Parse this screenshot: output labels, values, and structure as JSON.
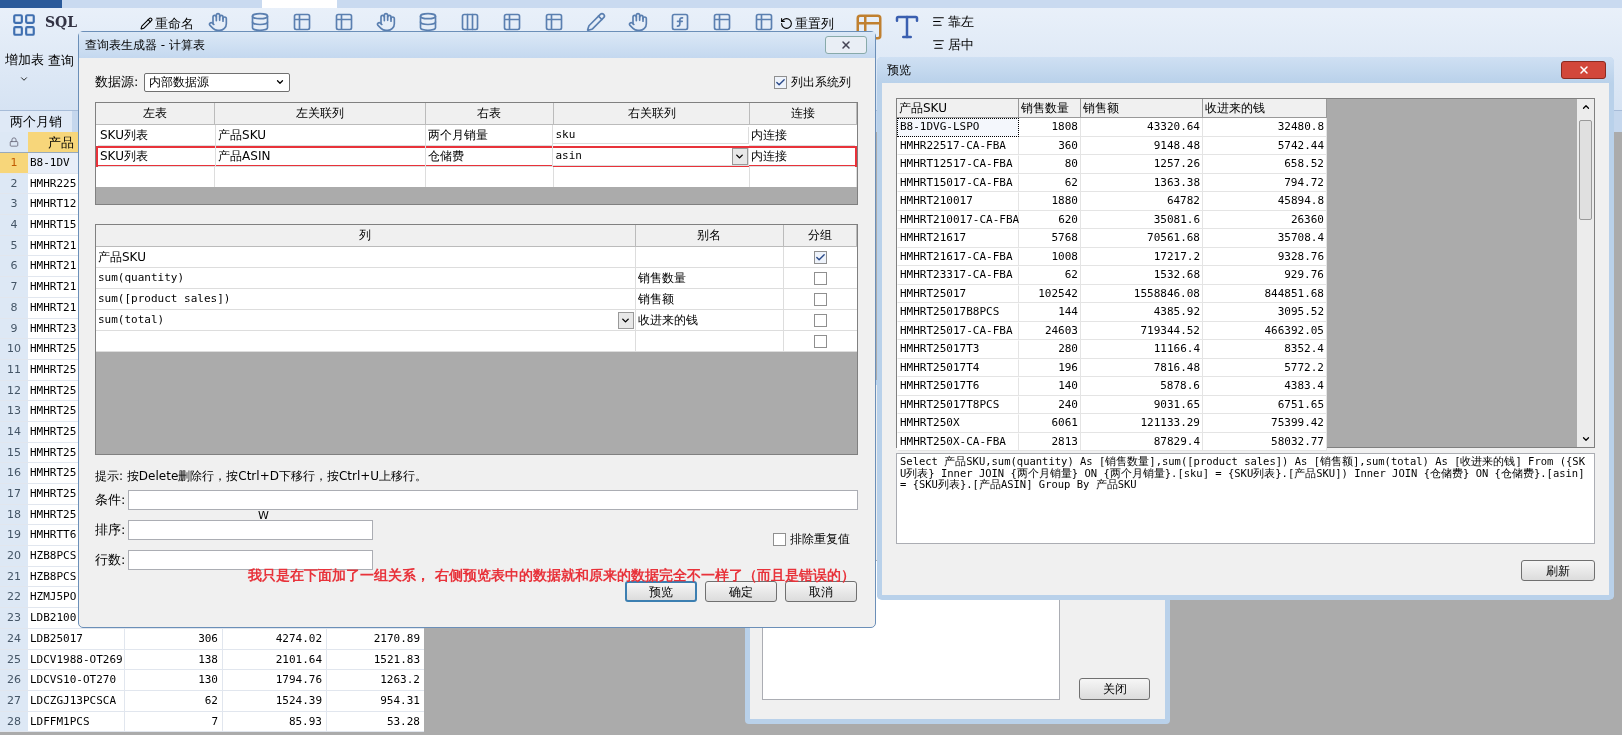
{
  "ribbon": {
    "big_buttons": [
      {
        "label": "增加表"
      },
      {
        "label": "查询"
      }
    ],
    "sql_label": "SQL",
    "small_buttons": [
      {
        "label": "重命名"
      },
      {
        "label": "重置列"
      }
    ],
    "align_buttons": [
      {
        "label": "靠左"
      },
      {
        "label": "居中"
      }
    ]
  },
  "sheet_tab": {
    "label": "两个月销"
  },
  "grid": {
    "header": "产品",
    "rows": [
      {
        "number": "1",
        "sku": "B8-1DV",
        "selected": true
      },
      {
        "number": "2",
        "sku": "HMHR225",
        "selected": false
      },
      {
        "number": "3",
        "sku": "HMHRT12",
        "selected": false
      },
      {
        "number": "4",
        "sku": "HMHRT15",
        "selected": false
      },
      {
        "number": "5",
        "sku": "HMHRT21",
        "selected": false
      },
      {
        "number": "6",
        "sku": "HMHRT21",
        "selected": false
      },
      {
        "number": "7",
        "sku": "HMHRT21",
        "selected": false
      },
      {
        "number": "8",
        "sku": "HMHRT21",
        "selected": false
      },
      {
        "number": "9",
        "sku": "HMHRT23",
        "selected": false
      },
      {
        "number": "10",
        "sku": "HMHRT25",
        "selected": false
      },
      {
        "number": "11",
        "sku": "HMHRT25",
        "selected": false
      },
      {
        "number": "12",
        "sku": "HMHRT25",
        "selected": false
      },
      {
        "number": "13",
        "sku": "HMHRT25",
        "selected": false
      },
      {
        "number": "14",
        "sku": "HMHRT25",
        "selected": false
      },
      {
        "number": "15",
        "sku": "HMHRT25",
        "selected": false
      },
      {
        "number": "16",
        "sku": "HMHRT25",
        "selected": false
      },
      {
        "number": "17",
        "sku": "HMHRT25",
        "selected": false
      },
      {
        "number": "18",
        "sku": "HMHRT25",
        "selected": false
      },
      {
        "number": "19",
        "sku": "HMHRTT6",
        "selected": false
      },
      {
        "number": "20",
        "sku": "HZB8PCS",
        "selected": false
      },
      {
        "number": "21",
        "sku": "HZB8PCS",
        "selected": false
      },
      {
        "number": "22",
        "sku": "HZMJ5PO",
        "selected": false
      },
      {
        "number": "23",
        "sku": "LDB2100",
        "selected": false
      },
      {
        "number": "24",
        "sku": "LDB25017",
        "column_3": "306",
        "column_4": "4274.02",
        "column_5": "2170.89",
        "selected": false
      },
      {
        "number": "25",
        "sku": "LDCV1988-OT269",
        "column_3": "138",
        "column_4": "2101.64",
        "column_5": "1521.83",
        "selected": false
      },
      {
        "number": "26",
        "sku": "LDCVS10-OT270",
        "column_3": "130",
        "column_4": "1794.76",
        "column_5": "1263.2",
        "selected": false
      },
      {
        "number": "27",
        "sku": "LDCZGJ13PCSCA",
        "column_3": "62",
        "column_4": "1524.39",
        "column_5": "954.31",
        "selected": false
      },
      {
        "number": "28",
        "sku": "LDFFM1PCS",
        "column_3": "7",
        "column_4": "85.93",
        "column_5": "53.28",
        "selected": false
      }
    ]
  },
  "back_window": {
    "close_button": "关闭"
  },
  "dialog": {
    "title": "查询表生成器 - 计算表",
    "datasource": {
      "label": "数据源:",
      "value": "内部数据源"
    },
    "system_columns": {
      "label": "列出系统列",
      "checked": true
    },
    "joins": {
      "columns": [
        "左表",
        "左关联列",
        "右表",
        "右关联列",
        "连接"
      ],
      "rows": [
        {
          "left_table": "SKU列表",
          "left_column": "产品SKU",
          "right_table": "两个月销量",
          "right_column": "sku",
          "join": "内连接",
          "dropdown": false,
          "highlighted": false
        },
        {
          "left_table": "SKU列表",
          "left_column": "产品ASIN",
          "right_table": "仓储费",
          "right_column": "asin",
          "join": "内连接",
          "dropdown": true,
          "highlighted": true
        }
      ]
    },
    "columns": {
      "columns": [
        "列",
        "别名",
        "分组"
      ],
      "rows": [
        {
          "expression": "产品SKU",
          "alias": "",
          "group": true,
          "dropdown": false
        },
        {
          "expression": "sum(quantity)",
          "alias": "销售数量",
          "group": false,
          "dropdown": false
        },
        {
          "expression": "sum([product sales])",
          "alias": "销售额",
          "group": false,
          "dropdown": false
        },
        {
          "expression": "sum(total)",
          "alias": "收进来的钱",
          "group": false,
          "dropdown": true
        },
        {
          "expression": "",
          "alias": "",
          "group": false,
          "dropdown": false
        }
      ]
    },
    "hint": "提示: 按Delete删除行，按Ctrl+D下移行，按Ctrl+U上移行。",
    "fields": [
      {
        "label": "条件:"
      },
      {
        "label": "排序:"
      },
      {
        "label": "行数:"
      }
    ],
    "stray_mark": "W",
    "distinct": {
      "label": "排除重复值",
      "checked": false
    },
    "buttons": [
      {
        "label": "预览",
        "focused": true
      },
      {
        "label": "确定",
        "focused": false
      },
      {
        "label": "取消",
        "focused": false
      }
    ]
  },
  "annotation": "我只是在下面加了一组关系， 右侧预览表中的数据就和原来的数据完全不一样了（而且是错误的）",
  "preview": {
    "title": "预览",
    "columns": [
      "产品SKU",
      "销售数量",
      "销售额",
      "收进来的钱"
    ],
    "rows": [
      {
        "sku": "B8-1DVG-LSPO",
        "qty": "1808",
        "sales": "43320.64",
        "total": "32480.8",
        "selected": true
      },
      {
        "sku": "HMHR22517-CA-FBA",
        "qty": "360",
        "sales": "9148.48",
        "total": "5742.44",
        "selected": false
      },
      {
        "sku": "HMHRT12517-CA-FBA",
        "qty": "80",
        "sales": "1257.26",
        "total": "658.52",
        "selected": false
      },
      {
        "sku": "HMHRT15017-CA-FBA",
        "qty": "62",
        "sales": "1363.38",
        "total": "794.72",
        "selected": false
      },
      {
        "sku": "HMHRT210017",
        "qty": "1880",
        "sales": "64782",
        "total": "45894.8",
        "selected": false
      },
      {
        "sku": "HMHRT210017-CA-FBA",
        "qty": "620",
        "sales": "35081.6",
        "total": "26360",
        "selected": false
      },
      {
        "sku": "HMHRT21617",
        "qty": "5768",
        "sales": "70561.68",
        "total": "35708.4",
        "selected": false
      },
      {
        "sku": "HMHRT21617-CA-FBA",
        "qty": "1008",
        "sales": "17217.2",
        "total": "9328.76",
        "selected": false
      },
      {
        "sku": "HMHRT23317-CA-FBA",
        "qty": "62",
        "sales": "1532.68",
        "total": "929.76",
        "selected": false
      },
      {
        "sku": "HMHRT25017",
        "qty": "102542",
        "sales": "1558846.08",
        "total": "844851.68",
        "selected": false
      },
      {
        "sku": "HMHRT25017B8PCS",
        "qty": "144",
        "sales": "4385.92",
        "total": "3095.52",
        "selected": false
      },
      {
        "sku": "HMHRT25017-CA-FBA",
        "qty": "24603",
        "sales": "719344.52",
        "total": "466392.05",
        "selected": false
      },
      {
        "sku": "HMHRT25017T3",
        "qty": "280",
        "sales": "11166.4",
        "total": "8352.4",
        "selected": false
      },
      {
        "sku": "HMHRT25017T4",
        "qty": "196",
        "sales": "7816.48",
        "total": "5772.2",
        "selected": false
      },
      {
        "sku": "HMHRT25017T6",
        "qty": "140",
        "sales": "5878.6",
        "total": "4383.4",
        "selected": false
      },
      {
        "sku": "HMHRT25017T8PCS",
        "qty": "240",
        "sales": "9031.65",
        "total": "6751.65",
        "selected": false
      },
      {
        "sku": "HMHRT250X",
        "qty": "6061",
        "sales": "121133.29",
        "total": "75399.42",
        "selected": false
      },
      {
        "sku": "HMHRT250X-CA-FBA",
        "qty": "2813",
        "sales": "87829.4",
        "total": "58032.77",
        "selected": false
      }
    ],
    "sql": "Select  产品SKU,sum(quantity) As [销售数量],sum([product sales]) As [销售额],sum(total) As [收进来的钱] From ({SKU列表} Inner JOIN {两个月销量} ON {两个月销量}.[sku] = {SKU列表}.[产品SKU]) Inner JOIN {仓储费} ON {仓储费}.[asin] = {SKU列表}.[产品ASIN] Group By 产品SKU",
    "refresh_button": "刷新"
  }
}
